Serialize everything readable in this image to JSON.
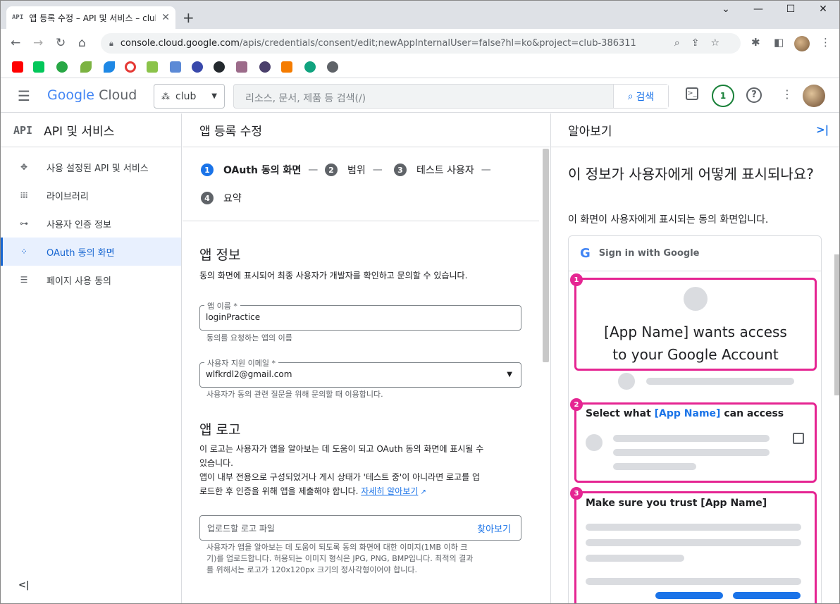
{
  "browser": {
    "tab_favicon": "API",
    "tab_title": "앱 등록 수정 – API 및 서비스 – club",
    "url_host": "console.cloud.google.com",
    "url_path": "/apis/credentials/consent/edit;newAppInternalUser=false?hl=ko&project=club-386311"
  },
  "header": {
    "logo_google": "Google",
    "logo_cloud": "Cloud",
    "project": "club",
    "search_placeholder": "리소스, 문서, 제품 등 검색(/)",
    "search_button": "검색",
    "notification_count": "1"
  },
  "leftnav": {
    "badge": "API",
    "title": "API 및 서비스",
    "items": [
      {
        "label": "사용 설정된 API 및 서비스",
        "icon": "api-diamond-icon"
      },
      {
        "label": "라이브러리",
        "icon": "library-icon"
      },
      {
        "label": "사용자 인증 정보",
        "icon": "key-icon"
      },
      {
        "label": "OAuth 동의 화면",
        "icon": "consent-dots-icon"
      },
      {
        "label": "페이지 사용 동의",
        "icon": "settings-list-icon"
      }
    ],
    "active_index": 3
  },
  "main": {
    "title": "앱 등록 수정",
    "steps": [
      {
        "num": "1",
        "label": "OAuth 동의 화면"
      },
      {
        "num": "2",
        "label": "범위"
      },
      {
        "num": "3",
        "label": "테스트 사용자"
      },
      {
        "num": "4",
        "label": "요약"
      }
    ],
    "app_info": {
      "title": "앱 정보",
      "desc": "동의 화면에 표시되어 최종 사용자가 개발자를 확인하고 문의할 수 있습니다.",
      "app_name_label": "앱 이름 *",
      "app_name_value": "loginPractice",
      "app_name_hint": "동의를 요청하는 앱의 이름",
      "email_label": "사용자 지원 이메일 *",
      "email_value": "wlfkrdl2@gmail.com",
      "email_hint": "사용자가 동의 관련 질문을 위해 문의할 때 이용합니다."
    },
    "app_logo": {
      "title": "앱 로고",
      "desc1": "이 로고는 사용자가 앱을 알아보는 데 도움이 되고 OAuth 동의 화면에 표시될 수",
      "desc2": "있습니다.",
      "desc3": "앱이 내부 전용으로 구성되었거나 게시 상태가 '테스트 중'이 아니라면 로고를 업",
      "desc4": "로드한 후 인증을 위해 앱을 제출해야 합니다.",
      "learn_more": "자세히 알아보기",
      "upload_placeholder": "업로드할 로고 파일",
      "browse": "찾아보기",
      "hint1": "사용자가 앱을 알아보는 데 도움이 되도록 동의 화면에 대한 이미지(1MB 이하 크",
      "hint2": "기)를 업로드합니다. 허용되는 이미지 형식은 JPG, PNG, BMP입니다. 최적의 결과",
      "hint3": "를 위해서는 로고가 120x120px 크기의 정사각형이어야 합니다."
    }
  },
  "right": {
    "title": "알아보기",
    "heading": "이 정보가 사용자에게 어떻게 표시되나요?",
    "desc": "이 화면이 사용자에게 표시되는 동의 화면입니다.",
    "mock": {
      "signin": "Sign in with Google",
      "box1_l1": "[App Name] wants access",
      "box1_l2": "to your Google Account",
      "box2_pre": "Select what ",
      "box2_accent": "[App Name]",
      "box2_post": " can access",
      "box3": "Make sure you trust [App Name]",
      "badges": [
        "1",
        "2",
        "3"
      ]
    }
  },
  "colors": {
    "accent": "#1a73e8",
    "highlight": "#e52592",
    "active_bg": "#e8f0fe"
  }
}
